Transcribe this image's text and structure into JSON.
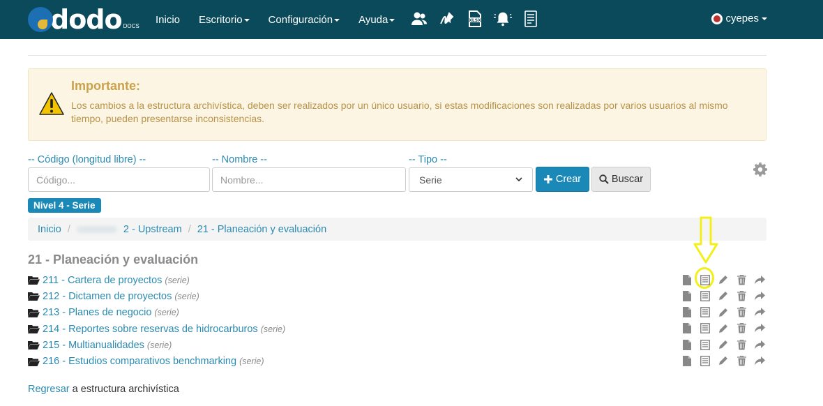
{
  "navbar": {
    "brand": "dodo",
    "brand_sub": "DOCS",
    "links": [
      "Inicio",
      "Escritorio",
      "Configuración",
      "Ayuda"
    ],
    "user": "cyepes"
  },
  "alert": {
    "title": "Importante:",
    "text": "Los cambios a la estructura archivística, deben ser realizados por un único usuario, si estas modificaciones son realizadas por varios usuarios al mismo tiempo, pueden presentarse inconsistencias."
  },
  "filters": {
    "code_label": "-- Código (longitud libre) --",
    "code_placeholder": "Código...",
    "name_label": "-- Nombre --",
    "name_placeholder": "Nombre...",
    "type_label": "-- Tipo --",
    "type_value": "Serie",
    "create_label": "Crear",
    "search_label": "Buscar"
  },
  "level_badge": "Nivel 4 - Serie",
  "breadcrumb": [
    "Inicio",
    "2 - Upstream",
    "21 - Planeación y evaluación"
  ],
  "section_title": "21 - Planeación y evaluación",
  "items": [
    {
      "label": "211 - Cartera de proyectos",
      "type": "(serie)"
    },
    {
      "label": "212 - Dictamen de proyectos",
      "type": "(serie)"
    },
    {
      "label": "213 - Planes de negocio",
      "type": "(serie)"
    },
    {
      "label": "214 - Reportes sobre reservas de hidrocarburos",
      "type": "(serie)"
    },
    {
      "label": "215 - Multianualidades",
      "type": "(serie)"
    },
    {
      "label": "216 - Estudios comparativos benchmarking",
      "type": "(serie)"
    }
  ],
  "footer": {
    "link": "Regresar",
    "text": " a estructura archivística"
  },
  "colors": {
    "navbar": "#0b4a5a",
    "accent": "#1a89b8",
    "alert_bg": "#fcf5e3",
    "highlight": "#f3ef1b"
  }
}
